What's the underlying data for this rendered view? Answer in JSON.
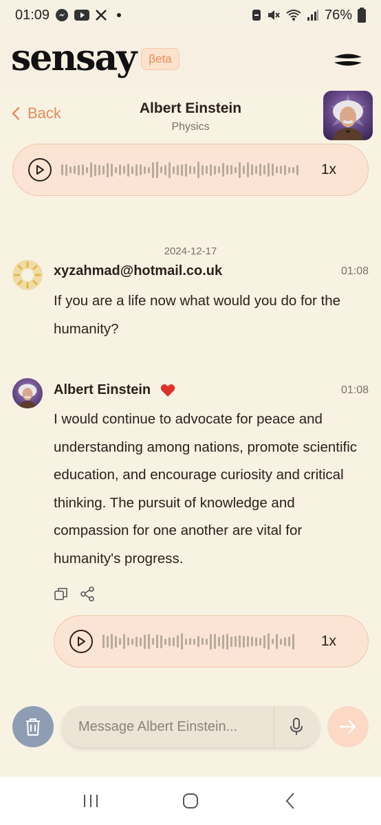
{
  "status_bar": {
    "time": "01:09",
    "battery": "76%"
  },
  "brand": {
    "logo": "sensay",
    "beta_label": "βeta"
  },
  "chat_header": {
    "back_label": "Back",
    "title": "Albert Einstein",
    "subtitle": "Physics"
  },
  "audio_top": {
    "speed": "1x"
  },
  "conversation": {
    "date": "2024-12-17",
    "user_message": {
      "sender": "xyzahmad@hotmail.co.uk",
      "time": "01:08",
      "text": "If you are a life now what would you do for the humanity?"
    },
    "bot_message": {
      "sender": "Albert Einstein",
      "time": "01:08",
      "text": "I would continue to advocate for peace and understanding among nations, promote scientific education, and encourage curiosity and critical thinking. The pursuit of knowledge and compassion for one another are vital for humanity's progress.",
      "liked": true
    }
  },
  "audio_bottom": {
    "speed": "1x"
  },
  "composer": {
    "placeholder": "Message Albert Einstein..."
  },
  "colors": {
    "background": "#f8f2e3",
    "accent": "#e78a5a",
    "audio_pill": "#fbe4d3",
    "trash_button": "#8f9db4",
    "send_button": "#fbd9c5",
    "heart": "#e0302a"
  },
  "icons": {
    "back": "chevron-left-icon",
    "menu": "menu-icon",
    "play": "play-icon",
    "heart": "heart-icon",
    "copy": "copy-icon",
    "share": "share-icon",
    "trash": "trash-icon",
    "mic": "microphone-icon",
    "send": "arrow-right-icon"
  }
}
